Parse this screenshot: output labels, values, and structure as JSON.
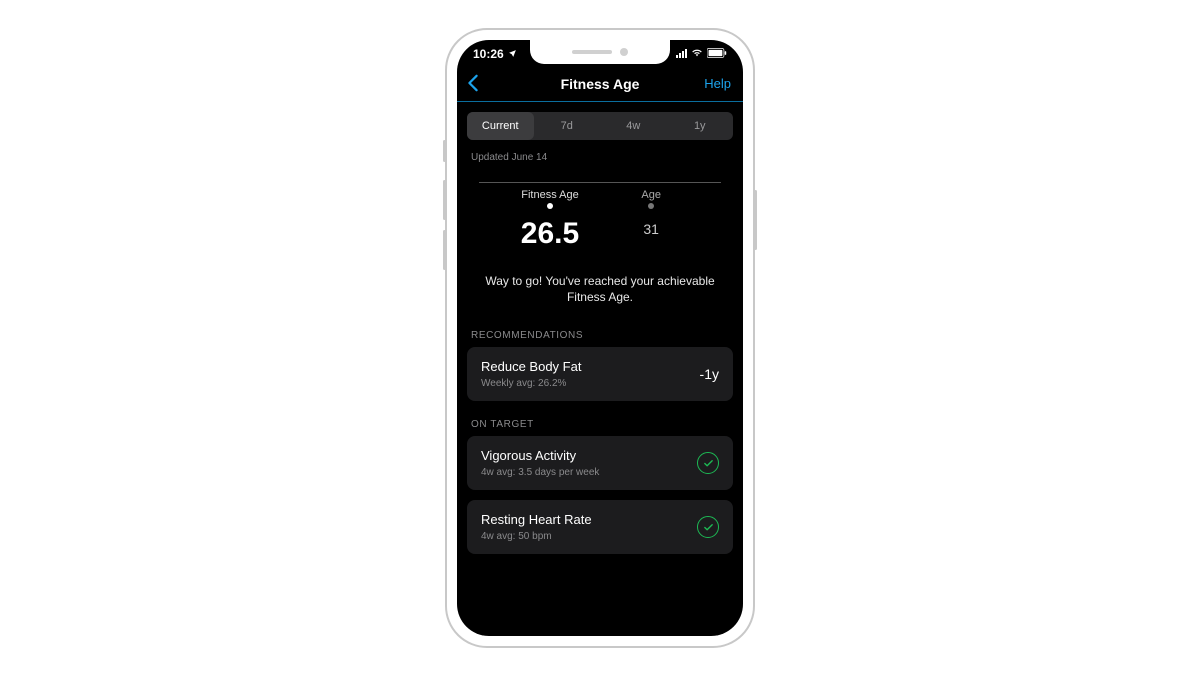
{
  "status": {
    "time": "10:26"
  },
  "nav": {
    "title": "Fitness Age",
    "help": "Help"
  },
  "segmented": {
    "current": "Current",
    "d7": "7d",
    "w4": "4w",
    "y1": "1y"
  },
  "updated": "Updated June 14",
  "age": {
    "fitness_label": "Fitness Age",
    "fitness_value": "26.5",
    "age_label": "Age",
    "age_value": "31"
  },
  "message": "Way to go! You've reached your achievable Fitness Age.",
  "sections": {
    "recommendations": "RECOMMENDATIONS",
    "on_target": "ON TARGET"
  },
  "cards": {
    "bodyfat": {
      "title": "Reduce Body Fat",
      "sub": "Weekly avg: 26.2%",
      "trail": "-1y"
    },
    "vigorous": {
      "title": "Vigorous Activity",
      "sub": "4w avg: 3.5 days per week"
    },
    "rhr": {
      "title": "Resting Heart Rate",
      "sub": "4w avg: 50 bpm"
    }
  }
}
